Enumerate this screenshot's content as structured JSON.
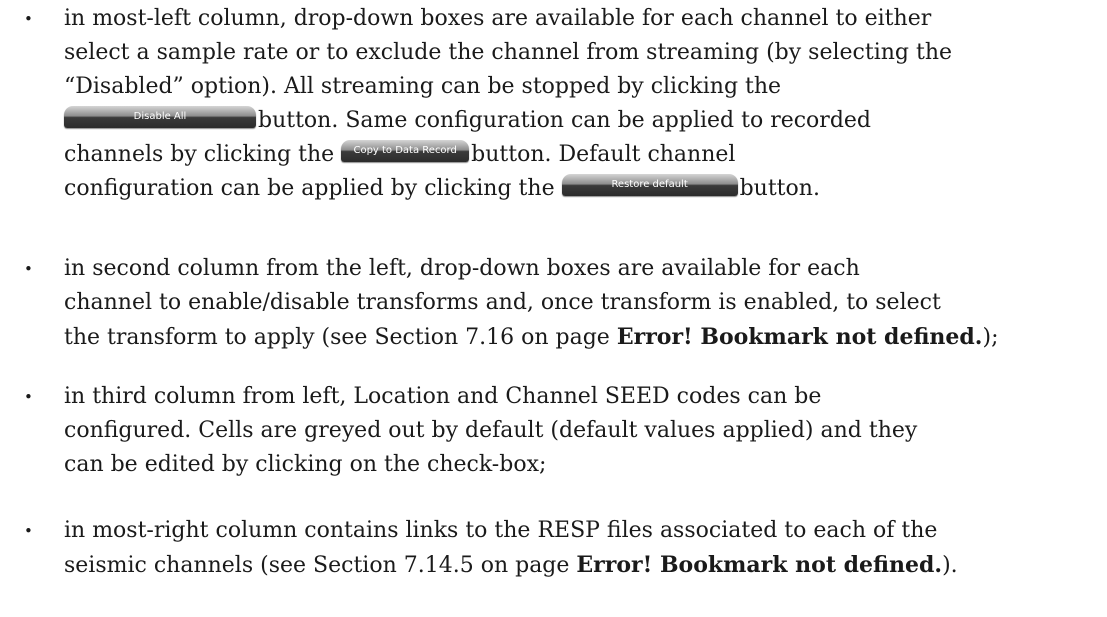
{
  "bullet_glyph": "•",
  "items": [
    {
      "lines": [
        "in most-left column, drop-down boxes are available for each channel to either",
        "select a sample rate or to exclude the channel from streaming (by selecting the",
        "“Disabled” option). All streaming can be stopped by clicking the",
        "button. Same configuration can be applied to recorded",
        "channels by clicking the",
        "button. Default channel",
        "configuration can be applied by clicking the",
        "button."
      ]
    },
    {
      "lines": [
        "in second column from the left, drop-down boxes are available for each",
        "channel to enable/disable transforms and, once transform is enabled, to select",
        "the transform to apply (see Section 7.16 on page ",
        "Error! Bookmark not defined.",
        ");"
      ]
    },
    {
      "lines": [
        "in third column from left, Location and Channel SEED codes can be",
        "configured. Cells are greyed out by default (default values applied) and they",
        "can be edited by clicking on the check-box;"
      ]
    },
    {
      "lines": [
        "in most-right column contains links to the RESP files associated to each of the",
        "seismic channels (see Section 7.14.5 on page ",
        "Error! Bookmark not defined.",
        ")."
      ]
    }
  ],
  "buttons": {
    "disable_all": "Disable All",
    "copy_to_data_record": "Copy to Data Record",
    "restore_default": "Restore default"
  }
}
